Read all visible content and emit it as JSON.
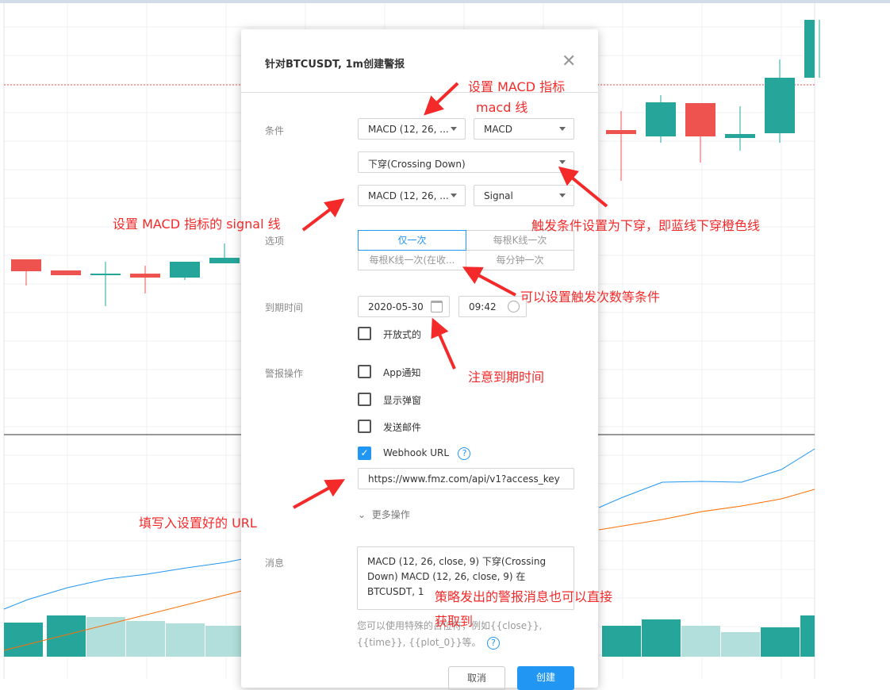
{
  "dialog": {
    "title": "针对BTCUSDT, 1m创建警报",
    "close_icon": "close-icon",
    "condition_label": "条件",
    "cond_indicator_1": "MACD (12, 26, ...",
    "cond_line_1": "MACD",
    "cond_operator": "下穿(Crossing Down)",
    "cond_indicator_2": "MACD (12, 26, ...",
    "cond_line_2": "Signal",
    "options_label": "选项",
    "options": [
      {
        "label": "仅一次",
        "selected": true
      },
      {
        "label": "每根K线一次",
        "selected": false
      },
      {
        "label": "每根K线一次(在收...",
        "selected": false
      },
      {
        "label": "每分钟一次",
        "selected": false
      }
    ],
    "expiry_label": "到期时间",
    "expiry_date": "2020-05-30",
    "expiry_time": "09:42",
    "open_ended_label": "开放式的",
    "open_ended_checked": false,
    "actions_label": "警报操作",
    "actions": [
      {
        "label": "App通知",
        "checked": false
      },
      {
        "label": "显示弹窗",
        "checked": false
      },
      {
        "label": "发送邮件",
        "checked": false
      },
      {
        "label": "Webhook URL",
        "checked": true
      }
    ],
    "webhook_url": "https://www.fmz.com/api/v1?access_key",
    "more_actions": "更多操作",
    "message_label": "消息",
    "message": "MACD (12, 26, close, 9) 下穿(Crossing Down) MACD (12, 26, close, 9) 在 BTCUSDT, 1",
    "hint": "您可以使用特殊的占位符，例如{{close}}, {{time}}, {{plot_0}}等。",
    "cancel": "取消",
    "create": "创建",
    "accent": "#2196f3"
  },
  "annotations": {
    "a1": "设置 MACD 指标",
    "a1b": "macd 线",
    "a2": "设置 MACD 指标的 signal 线",
    "a3": "触发条件设置为下穿，即蓝线下穿橙色线",
    "a4": "可以设置触发次数等条件",
    "a5": "注意到期时间",
    "a6": "填写入设置好的 URL",
    "a7": "策略发出的警报消息也可以直接",
    "a7b": "获取到",
    "color": "#f42a2a"
  },
  "chart_colors": {
    "up": "#26a69a",
    "down": "#ef5350",
    "macd": "#2196f3",
    "signal": "#ff6d00"
  }
}
